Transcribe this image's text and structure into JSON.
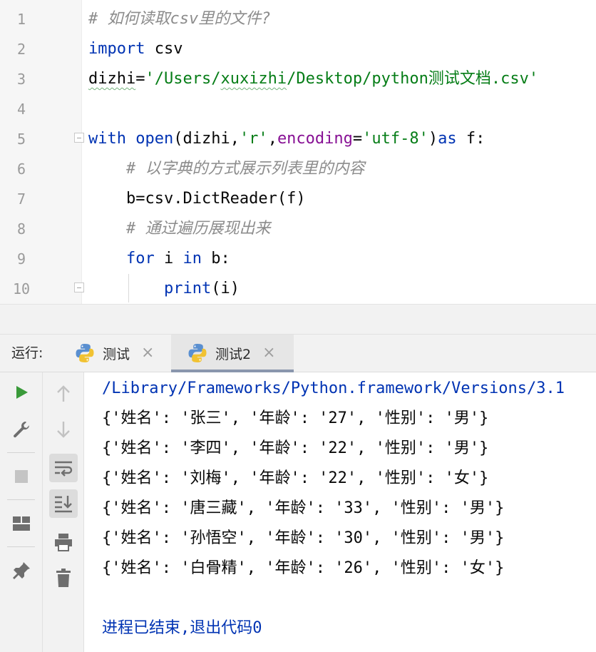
{
  "editor": {
    "line_numbers": [
      "1",
      "2",
      "3",
      "4",
      "5",
      "6",
      "7",
      "8",
      "9",
      "10"
    ],
    "lines": [
      [
        {
          "t": "# 如何读取",
          "c": "cmt"
        },
        {
          "t": "csv",
          "c": "cmt"
        },
        {
          "t": "里的文件?",
          "c": "cmt"
        }
      ],
      [
        {
          "t": "import",
          "c": "kw"
        },
        {
          "t": " csv",
          "c": "plain"
        }
      ],
      [
        {
          "t": "dizhi",
          "c": "plain sq"
        },
        {
          "t": "=",
          "c": "plain"
        },
        {
          "t": "'/Users/",
          "c": "str"
        },
        {
          "t": "xuxizhi",
          "c": "str sq"
        },
        {
          "t": "/Desktop/python测试文档.csv'",
          "c": "str"
        }
      ],
      [],
      [
        {
          "t": "with",
          "c": "kw"
        },
        {
          "t": " ",
          "c": "plain"
        },
        {
          "t": "open",
          "c": "fn"
        },
        {
          "t": "(dizhi,",
          "c": "plain"
        },
        {
          "t": "'r'",
          "c": "str"
        },
        {
          "t": ",",
          "c": "plain"
        },
        {
          "t": "encoding",
          "c": "kwarg"
        },
        {
          "t": "=",
          "c": "plain"
        },
        {
          "t": "'utf-8'",
          "c": "str"
        },
        {
          "t": ")",
          "c": "plain"
        },
        {
          "t": "as",
          "c": "kw"
        },
        {
          "t": " f:",
          "c": "plain"
        }
      ],
      [
        {
          "t": "    # 以字典的方式展示列表里的内容",
          "c": "cmt"
        }
      ],
      [
        {
          "t": "    b=csv.DictReader(f)",
          "c": "plain"
        }
      ],
      [
        {
          "t": "    # 通过遍历展现出来",
          "c": "cmt"
        }
      ],
      [
        {
          "t": "    ",
          "c": "plain"
        },
        {
          "t": "for",
          "c": "kw"
        },
        {
          "t": " i ",
          "c": "plain"
        },
        {
          "t": "in",
          "c": "kw"
        },
        {
          "t": " b:",
          "c": "plain"
        }
      ],
      [
        {
          "t": "        ",
          "c": "plain"
        },
        {
          "t": "print",
          "c": "fn"
        },
        {
          "t": "(i)",
          "c": "plain"
        }
      ]
    ]
  },
  "run_panel": {
    "label": "运行:",
    "tabs": [
      {
        "label": "测试",
        "active": false
      },
      {
        "label": "测试2",
        "active": true
      }
    ],
    "close_glyph": "×"
  },
  "toolbar": {
    "icons": [
      "run-icon",
      "wrench-icon",
      "stop-icon",
      "layout-icon",
      "pin-icon"
    ],
    "icons2": [
      "up-arrow-icon",
      "down-arrow-icon",
      "soft-wrap-icon",
      "scroll-to-end-icon",
      "print-icon",
      "trash-icon"
    ]
  },
  "console": {
    "path": "/Library/Frameworks/Python.framework/Versions/3.1",
    "rows": [
      "{'姓名': '张三', '年龄': '27', '性别': '男'}",
      "{'姓名': '李四', '年龄': '22', '性别': '男'}",
      "{'姓名': '刘梅', '年龄': '22', '性别': '女'}",
      "{'姓名': '唐三藏', '年龄': '33', '性别': '男'}",
      "{'姓名': '孙悟空', '年龄': '30', '性别': '男'}",
      "{'姓名': '白骨精', '年龄': '26', '性别': '女'}"
    ],
    "exit_message": "进程已结束,退出代码0"
  },
  "colors": {
    "keyword": "#0033b3",
    "string": "#067d17",
    "comment": "#8c8c8c",
    "kwarg": "#871094",
    "run_green": "#3a9a3a"
  }
}
